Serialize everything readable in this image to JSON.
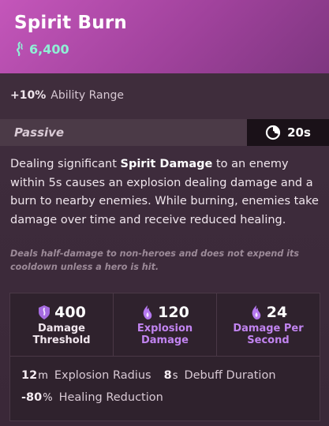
{
  "item": {
    "title": "Spirit Burn",
    "cost": "6,400",
    "colors": {
      "header": "#b04aa8",
      "cost": "#8ff0d6",
      "spirit_purple": "#c184f0"
    }
  },
  "bonus": {
    "value": "+10%",
    "label": "Ability Range"
  },
  "passive": {
    "label": "Passive",
    "cooldown": "20s",
    "cooldown_icon": "cooldown-clock-icon"
  },
  "description": {
    "part1": "Dealing significant ",
    "highlight": "Spirit Damage",
    "part2": " to an enemy within 5s causes an explosion dealing damage and a burn to nearby enemies. While burning, enemies take damage over time and receive reduced healing.",
    "note": "Deals half-damage to non-heroes and does not expend its cooldown unless a hero is hit."
  },
  "stats": {
    "columns": [
      {
        "icon": "shield-spirit-icon",
        "value": "400",
        "label": "Damage Threshold",
        "color": "white"
      },
      {
        "icon": "spirit-flame-icon",
        "value": "120",
        "label": "Explosion Damage",
        "color": "purple"
      },
      {
        "icon": "spirit-flame-icon",
        "value": "24",
        "label": "Damage Per Second",
        "color": "purple"
      }
    ],
    "rows": [
      {
        "num": "12",
        "unit": "m",
        "label": "Explosion Radius"
      },
      {
        "num": "8",
        "unit": "s",
        "label": "Debuff Duration"
      },
      {
        "num": "-80",
        "unit": "%",
        "label": "Healing Reduction"
      }
    ]
  }
}
